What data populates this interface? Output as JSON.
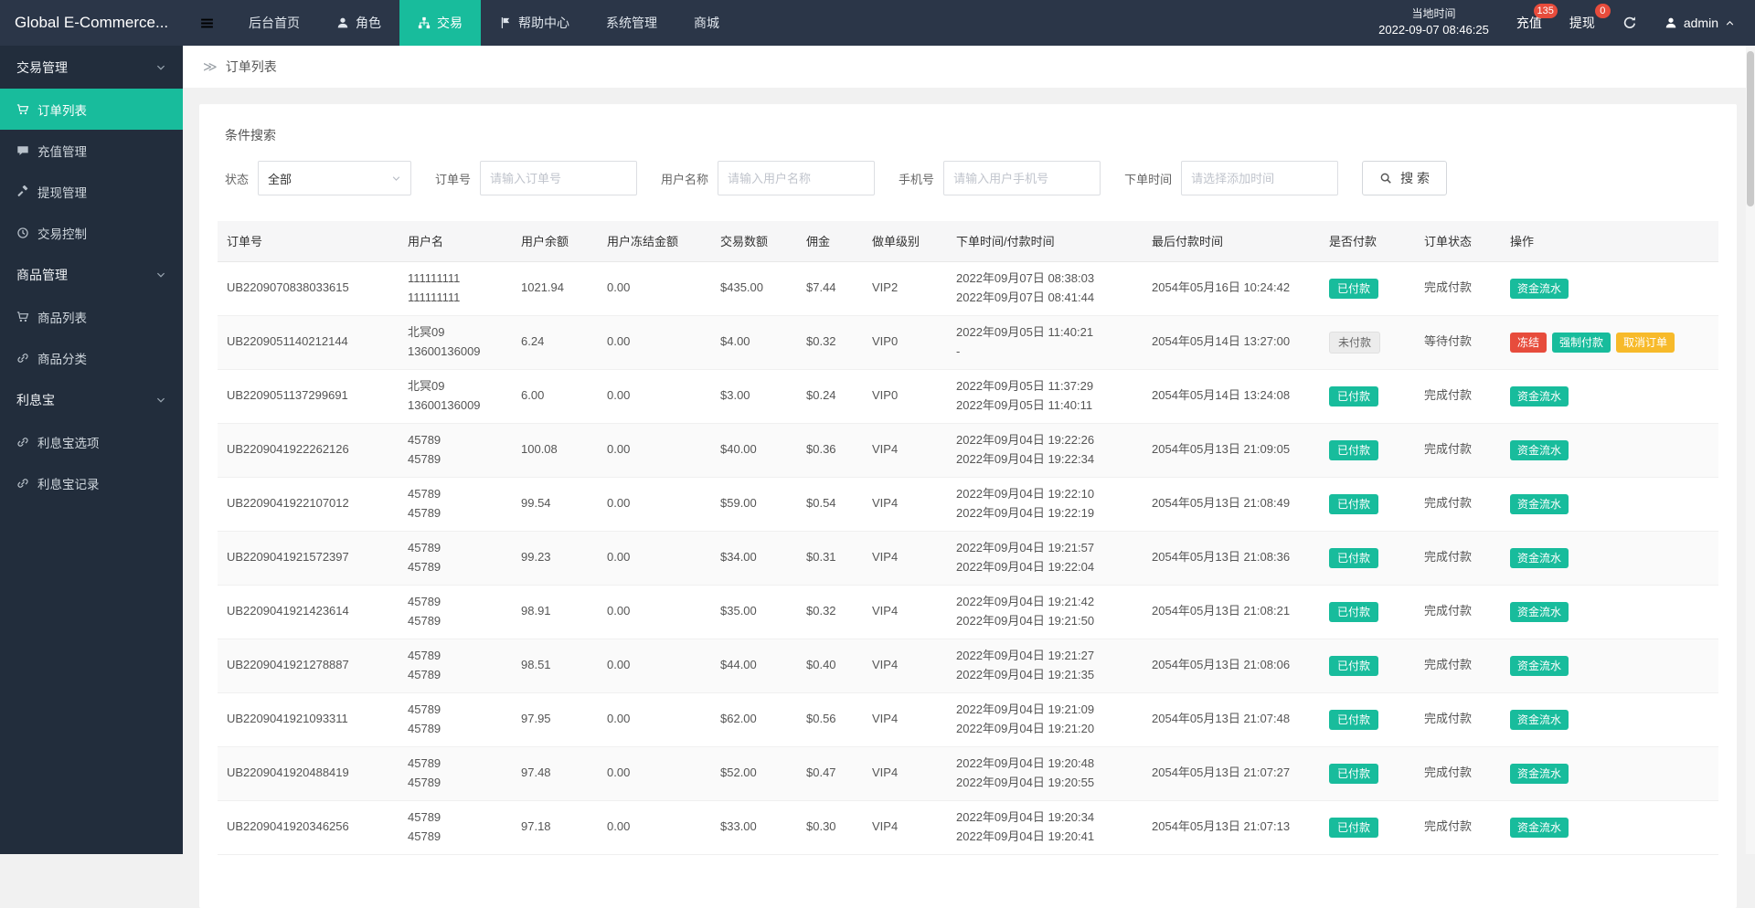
{
  "theme": {
    "header_bg": "#2b3648",
    "sidebar_bg": "#222d3c",
    "accent": "#18bc9c",
    "danger": "#e74c3c",
    "warning": "#f7ba2a",
    "content_bg": "#f1f1f1"
  },
  "header": {
    "logo": "Global E-Commerce...",
    "nav": [
      {
        "key": "home",
        "label": "后台首页"
      },
      {
        "key": "roles",
        "label": "角色",
        "icon": "user"
      },
      {
        "key": "trade",
        "label": "交易",
        "icon": "trade",
        "active": true
      },
      {
        "key": "help",
        "label": "帮助中心",
        "icon": "flag"
      },
      {
        "key": "system",
        "label": "系统管理"
      },
      {
        "key": "mall",
        "label": "商城"
      }
    ],
    "local_time_label": "当地时间",
    "local_time": "2022-09-07 08:46:25",
    "recharge": {
      "label": "充值",
      "badge": "135"
    },
    "withdraw": {
      "label": "提现",
      "badge": "0"
    },
    "admin_name": "admin"
  },
  "sidebar": {
    "groups": [
      {
        "key": "trade-manage",
        "label": "交易管理",
        "items": [
          {
            "key": "order-list",
            "label": "订单列表",
            "icon": "cart",
            "active": true
          },
          {
            "key": "recharge-manage",
            "label": "充值管理",
            "icon": "comment"
          },
          {
            "key": "withdraw-manage",
            "label": "提现管理",
            "icon": "gavel"
          },
          {
            "key": "trade-control",
            "label": "交易控制",
            "icon": "clock"
          }
        ]
      },
      {
        "key": "product-manage",
        "label": "商品管理",
        "items": [
          {
            "key": "product-list",
            "label": "商品列表",
            "icon": "cart"
          },
          {
            "key": "product-category",
            "label": "商品分类",
            "icon": "link"
          }
        ]
      },
      {
        "key": "lixibao",
        "label": "利息宝",
        "items": [
          {
            "key": "lixibao-options",
            "label": "利息宝选项",
            "icon": "link"
          },
          {
            "key": "lixibao-records",
            "label": "利息宝记录",
            "icon": "link"
          }
        ]
      }
    ]
  },
  "breadcrumb": {
    "current": "订单列表"
  },
  "filters": {
    "title": "条件搜索",
    "status": {
      "label": "状态",
      "value": "全部"
    },
    "order_no": {
      "label": "订单号",
      "placeholder": "请输入订单号"
    },
    "username": {
      "label": "用户名称",
      "placeholder": "请输入用户名称"
    },
    "phone": {
      "label": "手机号",
      "placeholder": "请输入用户手机号"
    },
    "order_time": {
      "label": "下单时间",
      "placeholder": "请选择添加时间"
    },
    "search_label": "搜 索"
  },
  "table": {
    "columns": [
      "订单号",
      "用户名",
      "用户余额",
      "用户冻结金额",
      "交易数额",
      "佣金",
      "做单级别",
      "下单时间/付款时间",
      "最后付款时间",
      "是否付款",
      "订单状态",
      "操作"
    ],
    "rows": [
      {
        "order_no": "UB2209070838033615",
        "user": [
          "111111111",
          "111111111"
        ],
        "balance": "1021.94",
        "frozen": "0.00",
        "amount": "$435.00",
        "commission": "$7.44",
        "level": "VIP2",
        "times": [
          "2022年09月07日 08:38:03",
          "2022年09月07日 08:41:44"
        ],
        "last_time": "2054年05月16日 10:24:42",
        "paid": "已付款",
        "paid_state": "paid",
        "status": "完成付款",
        "actions": [
          {
            "name": "fund-flow",
            "label": "资金流水",
            "type": "teal"
          }
        ]
      },
      {
        "order_no": "UB2209051140212144",
        "user": [
          "北冥09",
          "13600136009"
        ],
        "balance": "6.24",
        "frozen": "0.00",
        "amount": "$4.00",
        "commission": "$0.32",
        "level": "VIP0",
        "times": [
          "2022年09月05日 11:40:21",
          "-"
        ],
        "last_time": "2054年05月14日 13:27:00",
        "paid": "未付款",
        "paid_state": "unpaid",
        "status": "等待付款",
        "actions": [
          {
            "name": "freeze",
            "label": "冻结",
            "type": "red"
          },
          {
            "name": "force-pay",
            "label": "强制付款",
            "type": "teal"
          },
          {
            "name": "cancel-order",
            "label": "取消订单",
            "type": "orange"
          }
        ]
      },
      {
        "order_no": "UB2209051137299691",
        "user": [
          "北冥09",
          "13600136009"
        ],
        "balance": "6.00",
        "frozen": "0.00",
        "amount": "$3.00",
        "commission": "$0.24",
        "level": "VIP0",
        "times": [
          "2022年09月05日 11:37:29",
          "2022年09月05日 11:40:11"
        ],
        "last_time": "2054年05月14日 13:24:08",
        "paid": "已付款",
        "paid_state": "paid",
        "status": "完成付款",
        "actions": [
          {
            "name": "fund-flow",
            "label": "资金流水",
            "type": "teal"
          }
        ]
      },
      {
        "order_no": "UB2209041922262126",
        "user": [
          "45789",
          "45789"
        ],
        "balance": "100.08",
        "frozen": "0.00",
        "amount": "$40.00",
        "commission": "$0.36",
        "level": "VIP4",
        "times": [
          "2022年09月04日 19:22:26",
          "2022年09月04日 19:22:34"
        ],
        "last_time": "2054年05月13日 21:09:05",
        "paid": "已付款",
        "paid_state": "paid",
        "status": "完成付款",
        "actions": [
          {
            "name": "fund-flow",
            "label": "资金流水",
            "type": "teal"
          }
        ]
      },
      {
        "order_no": "UB2209041922107012",
        "user": [
          "45789",
          "45789"
        ],
        "balance": "99.54",
        "frozen": "0.00",
        "amount": "$59.00",
        "commission": "$0.54",
        "level": "VIP4",
        "times": [
          "2022年09月04日 19:22:10",
          "2022年09月04日 19:22:19"
        ],
        "last_time": "2054年05月13日 21:08:49",
        "paid": "已付款",
        "paid_state": "paid",
        "status": "完成付款",
        "actions": [
          {
            "name": "fund-flow",
            "label": "资金流水",
            "type": "teal"
          }
        ]
      },
      {
        "order_no": "UB2209041921572397",
        "user": [
          "45789",
          "45789"
        ],
        "balance": "99.23",
        "frozen": "0.00",
        "amount": "$34.00",
        "commission": "$0.31",
        "level": "VIP4",
        "times": [
          "2022年09月04日 19:21:57",
          "2022年09月04日 19:22:04"
        ],
        "last_time": "2054年05月13日 21:08:36",
        "paid": "已付款",
        "paid_state": "paid",
        "status": "完成付款",
        "actions": [
          {
            "name": "fund-flow",
            "label": "资金流水",
            "type": "teal"
          }
        ]
      },
      {
        "order_no": "UB2209041921423614",
        "user": [
          "45789",
          "45789"
        ],
        "balance": "98.91",
        "frozen": "0.00",
        "amount": "$35.00",
        "commission": "$0.32",
        "level": "VIP4",
        "times": [
          "2022年09月04日 19:21:42",
          "2022年09月04日 19:21:50"
        ],
        "last_time": "2054年05月13日 21:08:21",
        "paid": "已付款",
        "paid_state": "paid",
        "status": "完成付款",
        "actions": [
          {
            "name": "fund-flow",
            "label": "资金流水",
            "type": "teal"
          }
        ]
      },
      {
        "order_no": "UB2209041921278887",
        "user": [
          "45789",
          "45789"
        ],
        "balance": "98.51",
        "frozen": "0.00",
        "amount": "$44.00",
        "commission": "$0.40",
        "level": "VIP4",
        "times": [
          "2022年09月04日 19:21:27",
          "2022年09月04日 19:21:35"
        ],
        "last_time": "2054年05月13日 21:08:06",
        "paid": "已付款",
        "paid_state": "paid",
        "status": "完成付款",
        "actions": [
          {
            "name": "fund-flow",
            "label": "资金流水",
            "type": "teal"
          }
        ]
      },
      {
        "order_no": "UB2209041921093311",
        "user": [
          "45789",
          "45789"
        ],
        "balance": "97.95",
        "frozen": "0.00",
        "amount": "$62.00",
        "commission": "$0.56",
        "level": "VIP4",
        "times": [
          "2022年09月04日 19:21:09",
          "2022年09月04日 19:21:20"
        ],
        "last_time": "2054年05月13日 21:07:48",
        "paid": "已付款",
        "paid_state": "paid",
        "status": "完成付款",
        "actions": [
          {
            "name": "fund-flow",
            "label": "资金流水",
            "type": "teal"
          }
        ]
      },
      {
        "order_no": "UB2209041920488419",
        "user": [
          "45789",
          "45789"
        ],
        "balance": "97.48",
        "frozen": "0.00",
        "amount": "$52.00",
        "commission": "$0.47",
        "level": "VIP4",
        "times": [
          "2022年09月04日 19:20:48",
          "2022年09月04日 19:20:55"
        ],
        "last_time": "2054年05月13日 21:07:27",
        "paid": "已付款",
        "paid_state": "paid",
        "status": "完成付款",
        "actions": [
          {
            "name": "fund-flow",
            "label": "资金流水",
            "type": "teal"
          }
        ]
      },
      {
        "order_no": "UB2209041920346256",
        "user": [
          "45789",
          "45789"
        ],
        "balance": "97.18",
        "frozen": "0.00",
        "amount": "$33.00",
        "commission": "$0.30",
        "level": "VIP4",
        "times": [
          "2022年09月04日 19:20:34",
          "2022年09月04日 19:20:41"
        ],
        "last_time": "2054年05月13日 21:07:13",
        "paid": "已付款",
        "paid_state": "paid",
        "status": "完成付款",
        "actions": [
          {
            "name": "fund-flow",
            "label": "资金流水",
            "type": "teal"
          }
        ]
      }
    ]
  }
}
